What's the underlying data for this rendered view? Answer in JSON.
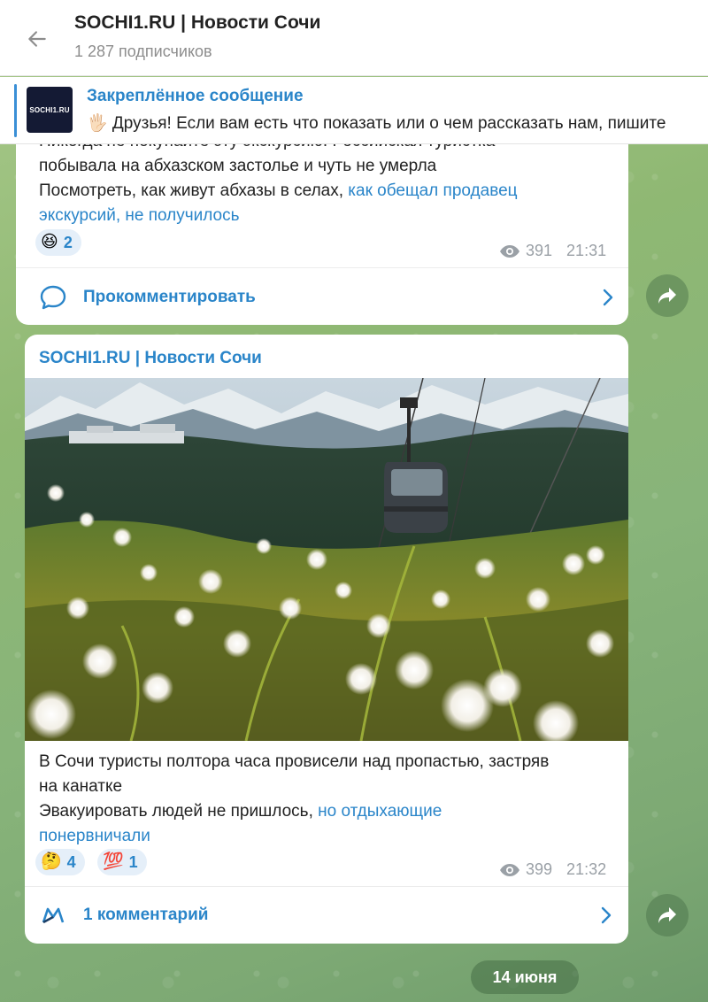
{
  "header": {
    "title": "SOCHI1.RU | Новости Сочи",
    "subscribers": "1 287 подписчиков"
  },
  "pinned": {
    "label": "Закреплённое сообщение",
    "thumb_logo": "SOCHI1.RU",
    "text": "🖐🏻 Друзья! Если вам есть что показать или о чем рассказать нам, пишите"
  },
  "post1": {
    "line_cut": "Никогда не покупайте эту экскурсию: Российская туристка",
    "line2": "побывала на абхазском застолье и чуть не умерла",
    "line3_plain": "Посмотреть, как живут абхазы в селах, ",
    "line3_link": "как обещал продавец",
    "line4_link": "экскурсий, не получилось",
    "reactions": [
      {
        "emoji": "😆",
        "count": "2"
      }
    ],
    "views": "391",
    "time": "21:31",
    "comment_label": "Прокомментировать"
  },
  "post2": {
    "sender": "SOCHI1.RU | Новости Сочи",
    "line1": "В Сочи туристы полтора часа провисели над пропастью, застряв",
    "line2": "на канатке",
    "line3_plain": "Эвакуировать людей не пришлось, ",
    "line3_link": "но отдыхающие",
    "line4_link": "понервничали",
    "reactions": [
      {
        "emoji": "🤔",
        "count": "4"
      },
      {
        "emoji": "💯",
        "count": "1"
      }
    ],
    "views": "399",
    "time": "21:32",
    "comment_label": "1 комментарий"
  },
  "date_divider": "14 июня",
  "colors": {
    "accent": "#2a85c9",
    "reaction_bg": "#e5eff9",
    "meta": "#9aa0a6"
  },
  "icons": {
    "back": "arrow-left-icon",
    "views": "eye-icon",
    "comment": "speech-bubble-icon",
    "commenter_avatar": "m-logo-icon",
    "chevron": "chevron-right-icon",
    "share": "share-arrow-icon"
  }
}
